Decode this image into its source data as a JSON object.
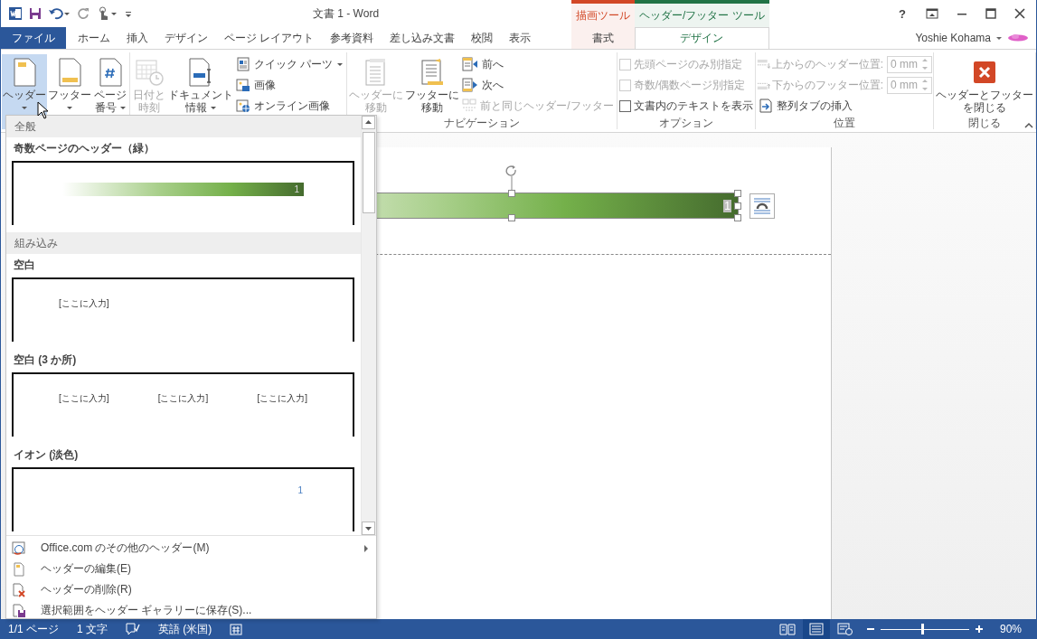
{
  "title_bar": {
    "title": "文書 1 - Word",
    "help": "?"
  },
  "tabs": [
    {
      "label": "ファイル",
      "kind": "file",
      "selected": false
    },
    {
      "label": "ホーム",
      "kind": "tab",
      "selected": false
    },
    {
      "label": "挿入",
      "kind": "tab",
      "selected": false
    },
    {
      "label": "デザイン",
      "kind": "tab",
      "selected": false
    },
    {
      "label": "ページ レイアウト",
      "kind": "tab",
      "selected": false
    },
    {
      "label": "参考資料",
      "kind": "tab",
      "selected": false
    },
    {
      "label": "差し込み文書",
      "kind": "tab",
      "selected": false
    },
    {
      "label": "校閲",
      "kind": "tab",
      "selected": false
    },
    {
      "label": "表示",
      "kind": "tab",
      "selected": false
    }
  ],
  "context_groups": [
    {
      "label": "描画ツール",
      "color": "#d24726",
      "tabs": [
        {
          "label": "書式",
          "selected": false
        }
      ]
    },
    {
      "label": "ヘッダー/フッター ツール",
      "color": "#217346",
      "tabs": [
        {
          "label": "デザイン",
          "selected": true
        }
      ]
    }
  ],
  "account": {
    "name": "Yoshie Kohama"
  },
  "ribbon": {
    "groups": [
      {
        "items": [
          {
            "kind": "large",
            "lines": [
              "ヘッダー"
            ],
            "caret": true,
            "pressed": true,
            "disabled": false
          },
          {
            "kind": "large",
            "lines": [
              "フッター"
            ],
            "caret": true,
            "pressed": false,
            "disabled": false
          },
          {
            "kind": "large",
            "lines": [
              "ページ",
              "番号"
            ],
            "caret": true,
            "pressed": false,
            "disabled": false
          }
        ]
      },
      {
        "items": [
          {
            "kind": "large",
            "lines": [
              "日付と",
              "時刻"
            ],
            "caret": false,
            "pressed": false,
            "disabled": true
          },
          {
            "kind": "large",
            "lines": [
              "ドキュメント",
              "情報"
            ],
            "caret": true,
            "pressed": false,
            "disabled": false
          },
          {
            "kind": "small",
            "label": "クイック パーツ",
            "caret": true,
            "disabled": false
          },
          {
            "kind": "small",
            "label": "画像",
            "caret": false,
            "disabled": false
          },
          {
            "kind": "small",
            "label": "オンライン画像",
            "caret": false,
            "disabled": false
          }
        ]
      },
      {
        "label": "ナビゲーション",
        "items": [
          {
            "kind": "large",
            "lines": [
              "ヘッダーに",
              "移動"
            ],
            "caret": false,
            "pressed": false,
            "disabled": true
          },
          {
            "kind": "large",
            "lines": [
              "フッターに",
              "移動"
            ],
            "caret": false,
            "pressed": false,
            "disabled": false
          },
          {
            "kind": "small",
            "label": "前へ",
            "caret": false,
            "disabled": false
          },
          {
            "kind": "small",
            "label": "次へ",
            "caret": false,
            "disabled": false
          },
          {
            "kind": "small",
            "label": "前と同じヘッダー/フッター",
            "caret": false,
            "disabled": true
          }
        ]
      },
      {
        "label": "オプション",
        "items": [
          {
            "kind": "check",
            "label": "先頭ページのみ別指定",
            "checked": false,
            "disabled": true
          },
          {
            "kind": "check",
            "label": "奇数/偶数ページ別指定",
            "checked": false,
            "disabled": true
          },
          {
            "kind": "check",
            "label": "文書内のテキストを表示",
            "checked": false,
            "disabled": false
          }
        ]
      },
      {
        "label": "位置",
        "items": [
          {
            "kind": "spin",
            "label": "上からのヘッダー位置:",
            "value": "0 mm",
            "disabled": true
          },
          {
            "kind": "spin",
            "label": "下からのフッター位置:",
            "value": "0 mm",
            "disabled": true
          },
          {
            "kind": "small",
            "label": "整列タブの挿入",
            "caret": false,
            "disabled": false
          }
        ]
      },
      {
        "label": "閉じる",
        "items": [
          {
            "kind": "large",
            "lines": [
              "ヘッダーとフッター",
              "を閉じる"
            ],
            "caret": false,
            "pressed": false,
            "disabled": false
          }
        ]
      }
    ]
  },
  "header_gallery": {
    "sections": [
      {
        "heading": "全般",
        "items": [
          {
            "name": "奇数ページのヘッダー（緑）",
            "preview": {
              "kind": "bar",
              "texts": [
                "1"
              ]
            }
          }
        ]
      },
      {
        "heading": "組み込み",
        "items": [
          {
            "name": "空白",
            "preview": {
              "kind": "placeholders",
              "texts": [
                "[ここに入力]"
              ]
            }
          },
          {
            "name": "空白 (3 か所)",
            "preview": {
              "kind": "placeholders",
              "texts": [
                "[ここに入力]",
                "[ここに入力]",
                "[ここに入力]"
              ]
            }
          },
          {
            "name": "イオン (淡色)",
            "preview": {
              "kind": "page-number",
              "texts": [
                "1"
              ]
            }
          }
        ]
      }
    ],
    "menu": [
      {
        "label": "Office.com のその他のヘッダー(M)",
        "submenu": true
      },
      {
        "label": "ヘッダーの編集(E)",
        "submenu": false
      },
      {
        "label": "ヘッダーの削除(R)",
        "submenu": false
      },
      {
        "label": "選択範囲をヘッダー ギャラリーに保存(S)...",
        "submenu": false
      }
    ]
  },
  "document": {
    "header_shape": {
      "text": "1"
    }
  },
  "status_bar": {
    "items": [
      "1/1 ページ",
      "1 文字",
      "英語 (米国)"
    ],
    "views": [
      {
        "kind": "read",
        "selected": false
      },
      {
        "kind": "print",
        "selected": true
      },
      {
        "kind": "web",
        "selected": false
      }
    ],
    "zoom": {
      "level": 0.47,
      "reading": "90%"
    }
  }
}
